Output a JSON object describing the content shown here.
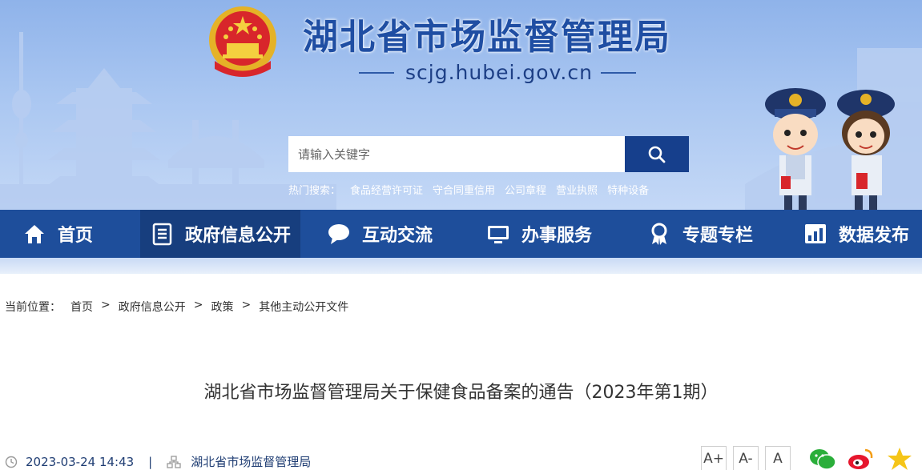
{
  "header": {
    "site_title": "湖北省市场监督管理局",
    "domain": "scjg.hubei.gov.cn",
    "emblem_icon": "national-emblem-icon",
    "search_placeholder": "请输入关键字",
    "search_icon": "search-icon",
    "hot_label": "热门搜索：",
    "hot_items": [
      "食品经营许可证",
      "守合同重信用",
      "公司章程",
      "营业执照",
      "特种设备"
    ]
  },
  "nav": {
    "items": [
      {
        "label": "首页",
        "icon": "home-icon",
        "active": false
      },
      {
        "label": "政府信息公开",
        "icon": "document-list-icon",
        "active": true
      },
      {
        "label": "互动交流",
        "icon": "chat-bubble-icon",
        "active": false
      },
      {
        "label": "办事服务",
        "icon": "monitor-icon",
        "active": false
      },
      {
        "label": "专题专栏",
        "icon": "award-ribbon-icon",
        "active": false
      },
      {
        "label": "数据发布",
        "icon": "bar-chart-icon",
        "active": false
      }
    ]
  },
  "breadcrumb": {
    "prefix": "当前位置：",
    "items": [
      "首页",
      "政府信息公开",
      "政策",
      "其他主动公开文件"
    ],
    "separator": ">"
  },
  "article": {
    "title": "湖北省市场监督管理局关于保健食品备案的通告（2023年第1期）",
    "datetime": "2023-03-24 14:43",
    "meta_divider": "|",
    "source": "湖北省市场监督管理局",
    "font_controls": [
      "A+",
      "A-",
      "A"
    ],
    "share": [
      "wechat-icon",
      "weibo-icon",
      "favorite-star-icon"
    ]
  },
  "colors": {
    "nav_bg": "#1e4e9b",
    "nav_active": "#173e7e",
    "title_blue": "#1f4ea3",
    "search_button": "#163f8c"
  }
}
